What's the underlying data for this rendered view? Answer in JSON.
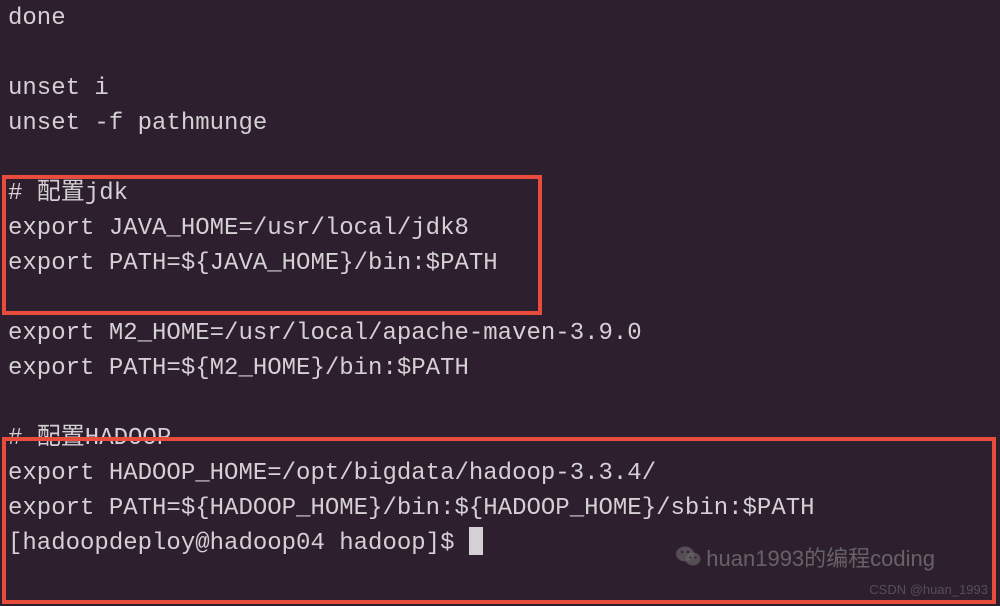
{
  "terminal": {
    "lines": [
      "done",
      "",
      "unset i",
      "unset -f pathmunge",
      "",
      "# 配置jdk",
      "export JAVA_HOME=/usr/local/jdk8",
      "export PATH=${JAVA_HOME}/bin:$PATH",
      "",
      "export M2_HOME=/usr/local/apache-maven-3.9.0",
      "export PATH=${M2_HOME}/bin:$PATH",
      "",
      "# 配置HADOOP",
      "export HADOOP_HOME=/opt/bigdata/hadoop-3.3.4/",
      "export PATH=${HADOOP_HOME}/bin:${HADOOP_HOME}/sbin:$PATH"
    ],
    "prompt": "[hadoopdeploy@hadoop04 hadoop]$ "
  },
  "watermark": {
    "text": "huan1993的编程coding",
    "csdn": "CSDN @huan_1993"
  }
}
